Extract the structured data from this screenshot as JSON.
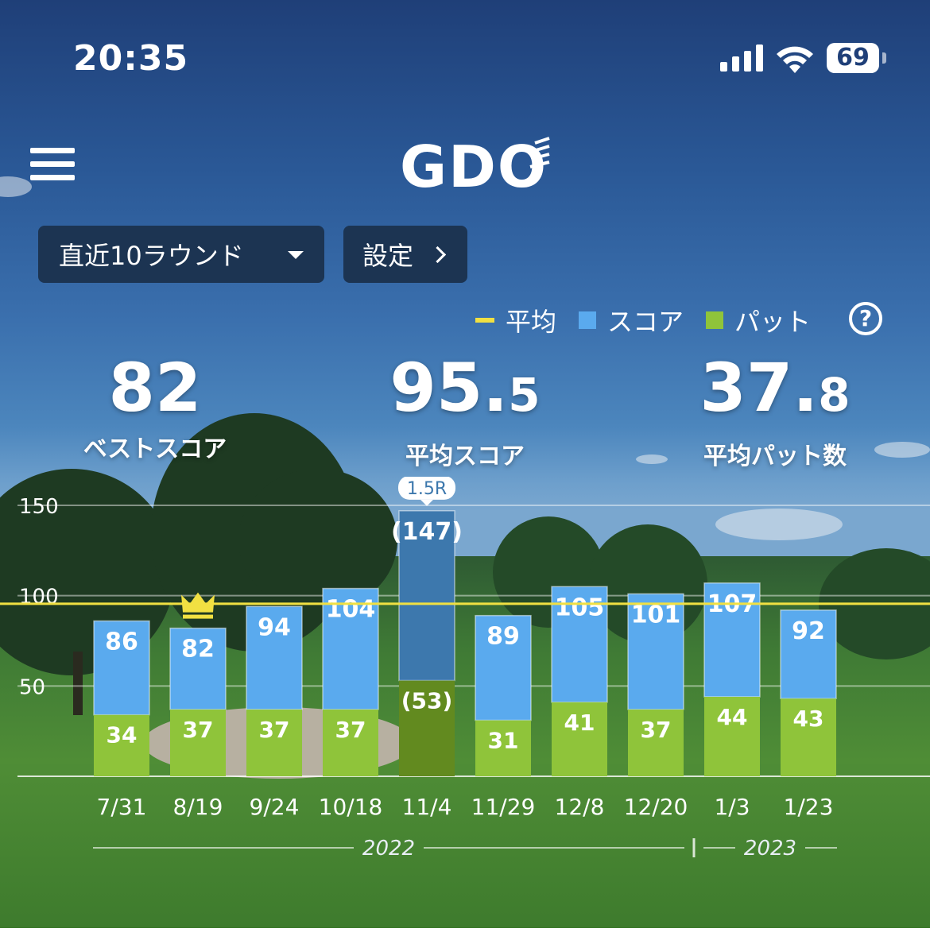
{
  "status": {
    "time": "20:35",
    "battery": "69"
  },
  "header": {
    "logo": "GDO",
    "menu_icon": "hamburger-icon"
  },
  "controls": {
    "range_label": "直近10ラウンド",
    "settings_label": "設定"
  },
  "legend": {
    "average": "平均",
    "score": "スコア",
    "putt": "パット"
  },
  "stats": {
    "best": {
      "value": "82",
      "label": "ベストスコア"
    },
    "avg_score": {
      "int": "95.",
      "dec": "5",
      "label": "平均スコア"
    },
    "avg_putt": {
      "int": "37.",
      "dec": "8",
      "label": "平均パット数"
    }
  },
  "colors": {
    "score": "#5aaaee",
    "putt": "#8fc43a",
    "score_dim": "#3d78ad",
    "putt_dim": "#628a1f",
    "average_line": "#f1e042",
    "crown": "#f1e042"
  },
  "chart_data": {
    "type": "bar",
    "categories": [
      "7/31",
      "8/19",
      "9/24",
      "10/18",
      "11/4",
      "11/29",
      "12/8",
      "12/20",
      "1/3",
      "1/23"
    ],
    "series": [
      {
        "name": "スコア",
        "values": [
          86,
          82,
          94,
          104,
          147,
          89,
          105,
          101,
          107,
          92
        ]
      },
      {
        "name": "パット",
        "values": [
          34,
          37,
          37,
          37,
          53,
          31,
          41,
          37,
          44,
          43
        ]
      }
    ],
    "score_labels": [
      "86",
      "82",
      "94",
      "104",
      "(147)",
      "89",
      "105",
      "101",
      "107",
      "92"
    ],
    "putt_labels": [
      "34",
      "37",
      "37",
      "37",
      "(53)",
      "31",
      "41",
      "37",
      "44",
      "43"
    ],
    "average": 95.5,
    "yticks": [
      "150",
      "100",
      "50"
    ],
    "ytick_values": [
      150,
      100,
      50
    ],
    "ylim": [
      0,
      150
    ],
    "best_round_index": 1,
    "partial_round": {
      "index": 4,
      "label": "1.5R"
    },
    "years": [
      {
        "label": "2022",
        "from": 0,
        "to": 7
      },
      {
        "label": "2023",
        "from": 8,
        "to": 9
      }
    ]
  }
}
